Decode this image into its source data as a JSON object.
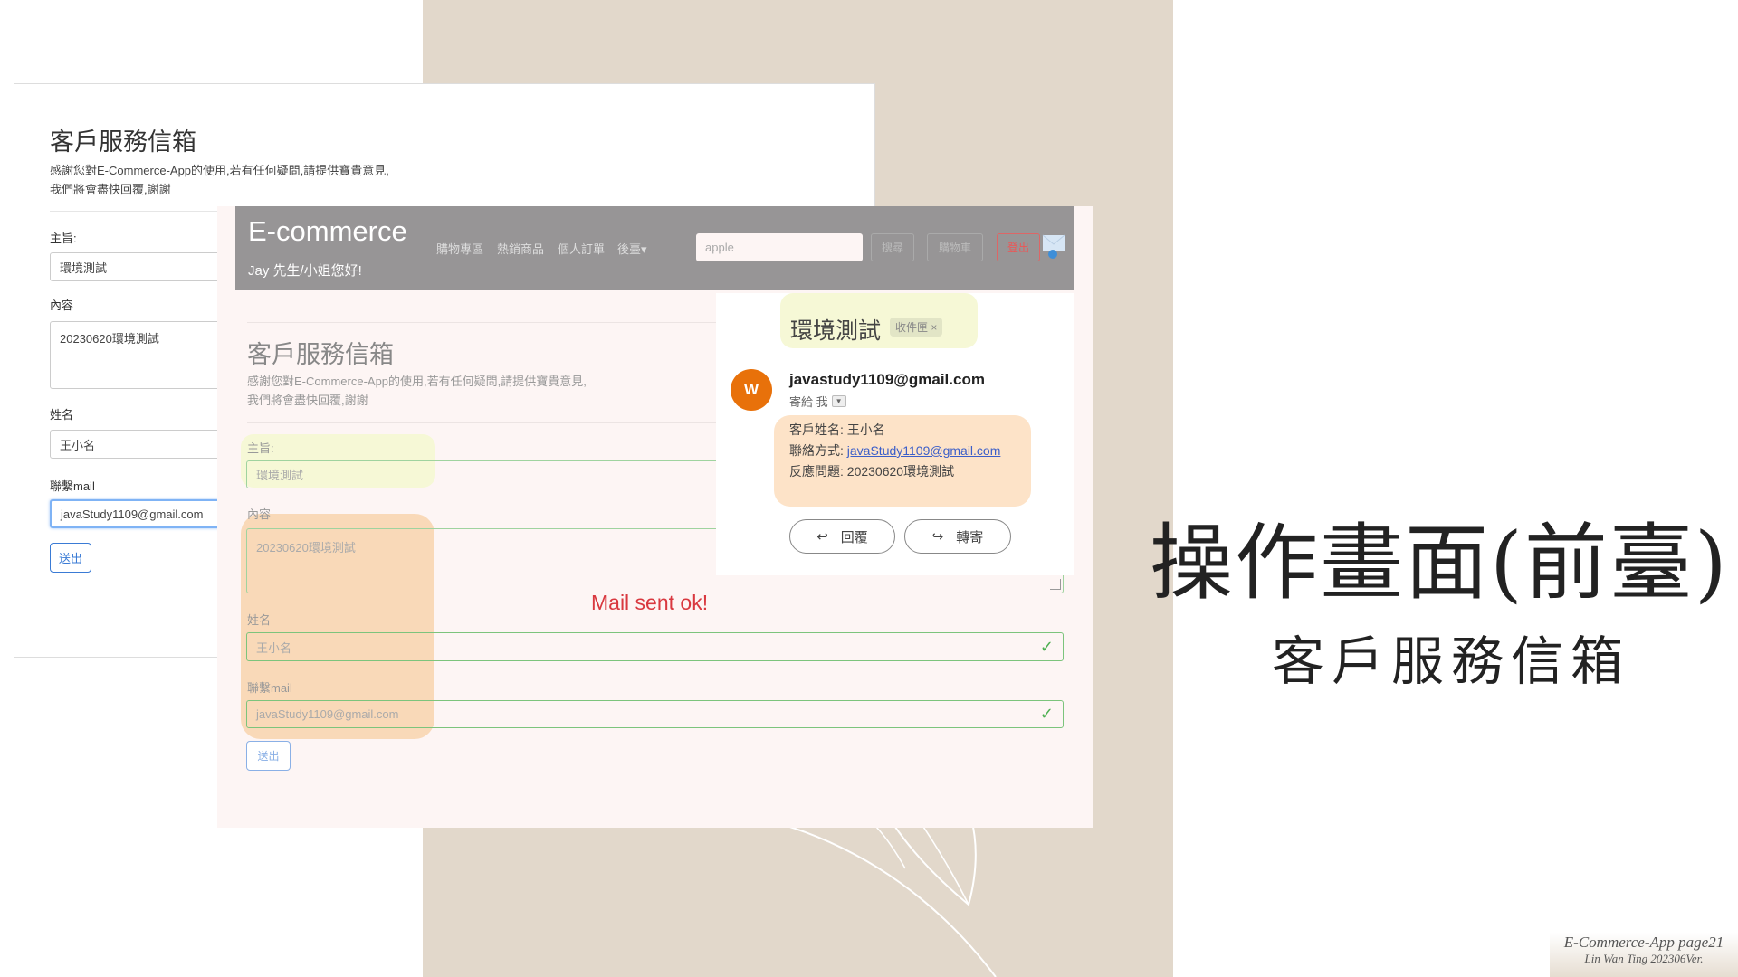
{
  "back_form": {
    "title": "客戶服務信箱",
    "desc_line1": "感謝您對E-Commerce-App的使用,若有任何疑問,請提供寶貴意見,",
    "desc_line2": "我們將會盡快回覆,謝謝",
    "subject_label": "主旨:",
    "subject_value": "環境測試",
    "content_label": "內容",
    "content_value": "20230620環境測試",
    "name_label": "姓名",
    "name_value": "王小名",
    "mail_label": "聯繫mail",
    "mail_value": "javaStudy1109@gmail.com",
    "submit_label": "送出"
  },
  "navbar": {
    "brand": "E-commerce",
    "greeting": "Jay 先生/小姐您好!",
    "items": [
      {
        "label": "購物專區"
      },
      {
        "label": "熱銷商品"
      },
      {
        "label": "個人訂單"
      },
      {
        "label": "後臺▾"
      }
    ],
    "search_value": "apple",
    "search_button": "搜尋",
    "cart_button": "購物車",
    "logout_button": "登出"
  },
  "front_form": {
    "title": "客戶服務信箱",
    "desc_line1": "感謝您對E-Commerce-App的使用,若有任何疑問,請提供寶貴意見,",
    "desc_line2": "我們將會盡快回覆,謝謝",
    "subject_label": "主旨:",
    "subject_value": "環境測試",
    "content_label": "內容",
    "content_value": "20230620環境測試",
    "name_label": "姓名",
    "name_value": "王小名",
    "mail_label": "聯繫mail",
    "mail_value": "javaStudy1109@gmail.com",
    "submit_label": "送出",
    "status": "Mail sent ok!"
  },
  "email": {
    "subject": "環境測試",
    "badge": "收件匣",
    "badge_close": "×",
    "avatar_letter": "W",
    "sender": "javastudy1109@gmail.com",
    "to": "寄給 我",
    "line1": "客戶姓名: 王小名",
    "line2_label": "聯絡方式: ",
    "line2_link": "javaStudy1109@gmail.com",
    "line3": "反應問題: 20230620環境測試",
    "reply": "回覆",
    "forward": "轉寄",
    "avatar_color": "#e8710a"
  },
  "slide": {
    "title": "操作畫面(前臺)",
    "subtitle": "客戶服務信箱",
    "footer1": "E-Commerce-App page21",
    "footer2": "Lin Wan Ting 202306Ver."
  }
}
